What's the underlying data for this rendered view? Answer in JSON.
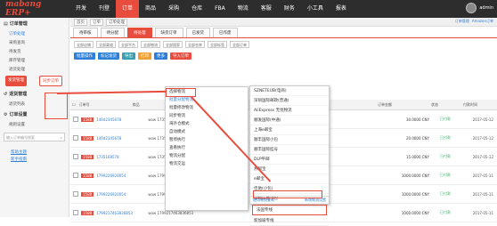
{
  "brand": {
    "logo": "mabang ERP+"
  },
  "nav": [
    "开发",
    "刊登",
    "订单",
    "商品",
    "采购",
    "仓库",
    "FBA",
    "物流",
    "客服",
    "财务",
    "小工具",
    "报表"
  ],
  "nav_active": 2,
  "user": {
    "name": "admin"
  },
  "sidebar": {
    "group1": "订单管理",
    "items": [
      "订单处理",
      "采购查询",
      "待发货",
      "库存管理",
      "退货处理"
    ],
    "btn1": "发货管理",
    "btn2": "同步订单",
    "group2": "退货管理",
    "items2": [
      "退货列表"
    ],
    "group3": "订单设置",
    "items3": [
      "规则设置"
    ],
    "search_placeholder": "输入订单编号搜索",
    "links": [
      "帮助主题",
      "新手指南"
    ]
  },
  "crumb": {
    "items": [
      "首页",
      "订单",
      "订单处理"
    ],
    "right": [
      "订单管理",
      "Amazon订单"
    ]
  },
  "tabs": [
    "待审核",
    "待分配",
    "待处理",
    "缺货订单",
    "已发货",
    "已作废"
  ],
  "tab_active": 2,
  "filters": [
    "全部店铺",
    "全部渠道",
    "全部平台",
    "全部物流",
    "全部国家",
    "全部仓库",
    "全部标签",
    "全部订单"
  ],
  "actions": {
    "btn_a": "批量操作",
    "btn_b": "标记发货",
    "btn_c": "导出",
    "btn_d": "打印",
    "btn_e": "更多",
    "btn_f": "导入订单"
  },
  "table": {
    "headers": [
      "订单号",
      "商品",
      "数量",
      "订单金额",
      "状态",
      "付款时间"
    ],
    "rows": [
      {
        "badge": "1588",
        "order": "140d2345678",
        "product": "wow 1735170458",
        "amount": "30.0000 CNY",
        "status": "已付款",
        "date": "2017-05-12"
      },
      {
        "badge": "1588",
        "order": "140d2345678",
        "product": "wow 1735170458",
        "amount": "20.0000 CNY",
        "status": "已付款",
        "date": "2017-05-12"
      },
      {
        "badge": "1588",
        "order": "1735168578",
        "product": "wow 1735166578",
        "amount": "15.0000 CNY",
        "status": "已付款",
        "date": "2017-05-12"
      },
      {
        "badge": "1588",
        "order": "1799226920054",
        "product": "wow 1799226920054",
        "amount": "1000.0000 CNY",
        "status": "已付款",
        "date": "2017-05-11"
      },
      {
        "badge": "1588",
        "order": "1799226920054",
        "product": "wow 1799226920054",
        "amount": "1000.0000 CNY",
        "status": "已付款",
        "date": "2017-05-11"
      },
      {
        "badge": "1588",
        "order": "1799217463836853",
        "product": "wow 1799217463836853",
        "amount": "1000.0000 CNY",
        "status": "已付款",
        "date": "2017-05-11"
      }
    ]
  },
  "dropdown": [
    "选择物流",
    "批量分配物流",
    "批量修改物流",
    "同步物流",
    "海外仓模式",
    "自动模式",
    "暂停执行",
    "查看执行",
    "物流分配",
    "物流交运"
  ],
  "submenu": [
    "SZNETEUB(电商)",
    "深圳国际邮政(普通)",
    "AliExpress 无忧物流",
    "顺发国际(中通)",
    "上海e邮宝",
    "顺丰国际小包",
    "顺丰国际挂号",
    "DLP平邮",
    "燕邮宝",
    "e邮宝",
    "佳驰(小包)",
    "深圳法优小包",
    "法国专线",
    "新加坡专线"
  ],
  "sub_foot": {
    "left": "使用物流查询",
    "right": "新增物流设置"
  }
}
